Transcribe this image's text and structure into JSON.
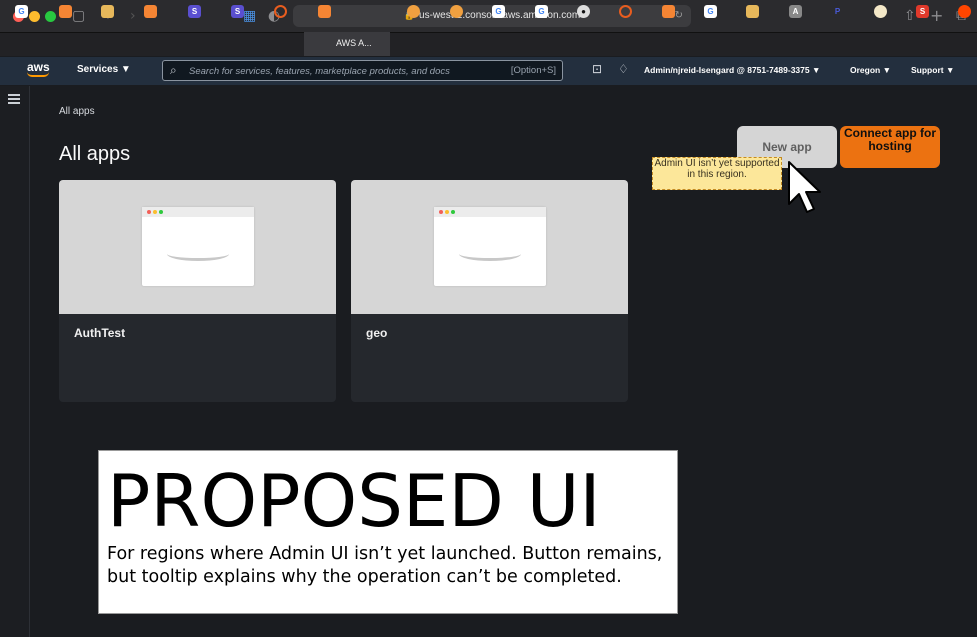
{
  "browser": {
    "url": "us-west-2.console.aws.amazon.com",
    "active_tab_title": "AWS A...",
    "icons": [
      "sidebar-toggle-icon",
      "back-icon",
      "forward-icon",
      "extension-icon",
      "shield-icon",
      "lock-icon",
      "reload-icon",
      "share-icon",
      "new-tab-icon",
      "tab-overview-icon"
    ]
  },
  "tabs": {
    "favicons": [
      "google",
      "aws",
      "cube",
      "aws",
      "s",
      "s",
      "block",
      "aws-active",
      "orange",
      "orange",
      "google",
      "google",
      "github",
      "block",
      "aws",
      "google",
      "cube",
      "a",
      "p",
      "dot",
      "s-red",
      "reddit"
    ]
  },
  "nav": {
    "logo": "aws",
    "services": "Services",
    "search_placeholder": "Search for services, features, marketplace products, and docs",
    "search_shortcut": "[Option+S]",
    "account": "Admin/njreid-Isengard @ 8751-7489-3375",
    "region": "Oregon",
    "support": "Support"
  },
  "page": {
    "breadcrumb": "All apps",
    "title": "All apps",
    "new_app_label": "New app",
    "connect_label": "Connect app for hosting",
    "tooltip": "Admin UI isn’t yet supported in this region."
  },
  "apps": [
    {
      "name": "AuthTest"
    },
    {
      "name": "geo"
    }
  ],
  "proposal": {
    "title": "PROPOSED UI",
    "body": "For regions where Admin UI isn’t yet launched. Button remains, but tooltip explains why the operation can’t be completed."
  },
  "colors": {
    "nav_bg": "#232f3e",
    "accent": "#ec7211",
    "tooltip_bg": "#fce79a",
    "disabled_button": "#d5d5d5"
  }
}
